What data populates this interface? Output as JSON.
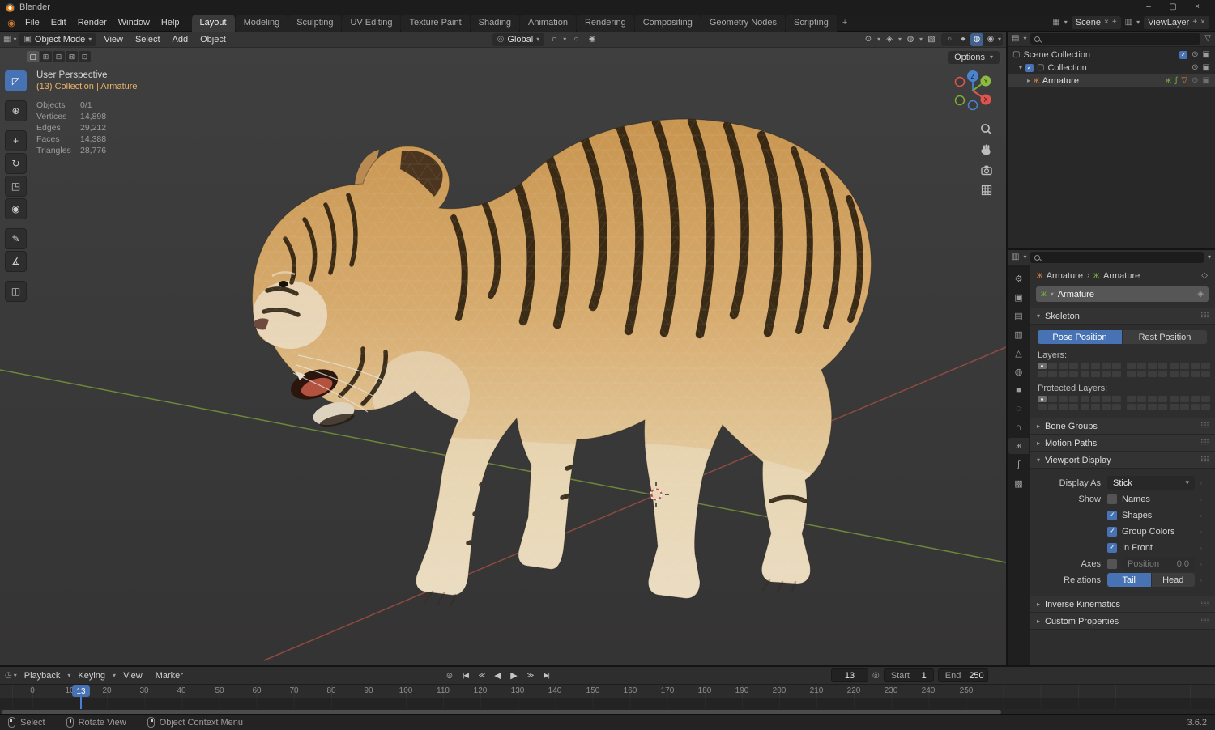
{
  "icons": {
    "dropdown": "▾",
    "collapsed": "▸",
    "expanded": "▾",
    "check": "✓",
    "close": "×",
    "minimize": "–",
    "maximize": "▢",
    "drag": "⠿⠿",
    "grid": "▦",
    "list": "▤",
    "sliders": "▥",
    "clock": "◷",
    "cube": "▣",
    "orientation": "◎",
    "magnet": "∩",
    "proportional": "○",
    "falloff": "◉",
    "visibility": "⊙",
    "gizmos": "◈",
    "overlays": "◍",
    "xray": "▧",
    "shade_wire": "○",
    "shade_solid": "●",
    "shade_material": "◍",
    "shade_render": "◉",
    "box": "▢",
    "person": "ж",
    "eye": "⊙",
    "camera": "▣",
    "filter": "▽",
    "pin": "◇",
    "shield": "◈",
    "chevron": "›",
    "decorator": "◦",
    "record": "◎",
    "bone": "∫",
    "triangle": "▽",
    "plus": "+",
    "select_modes": [
      "▢",
      "⊞",
      "⊟",
      "⊠",
      "⊡"
    ],
    "tools": [
      "◸",
      "⊕",
      "+",
      "↻",
      "◳",
      "◉",
      "✎",
      "∡",
      "◫"
    ],
    "transport": [
      "|◀",
      "≪",
      "◀",
      "▶",
      "≫",
      "▶|"
    ],
    "ptabs": [
      "⚙",
      "▣",
      "▤",
      "▥",
      "△",
      "◍",
      "■",
      "◌",
      "∩",
      "ж",
      "∫",
      "▩"
    ],
    "axis_z": "Z",
    "axis_x": "X",
    "axis_y": "Y"
  },
  "titlebar": {
    "title": "Blender"
  },
  "topbar": {
    "menus": [
      "File",
      "Edit",
      "Render",
      "Window",
      "Help"
    ],
    "workspaces": [
      "Layout",
      "Modeling",
      "Sculpting",
      "UV Editing",
      "Texture Paint",
      "Shading",
      "Animation",
      "Rendering",
      "Compositing",
      "Geometry Nodes",
      "Scripting"
    ],
    "add_tab": "+",
    "scene_label": "Scene",
    "viewlayer_label": "ViewLayer"
  },
  "viewport": {
    "mode": "Object Mode",
    "menus": [
      "View",
      "Select",
      "Add",
      "Object"
    ],
    "orientation": "Global",
    "options": "Options",
    "overlay": {
      "perspective": "User Perspective",
      "collection": "(13) Collection | Armature",
      "stats": [
        {
          "label": "Objects",
          "value": "0/1"
        },
        {
          "label": "Vertices",
          "value": "14,898"
        },
        {
          "label": "Edges",
          "value": "29,212"
        },
        {
          "label": "Faces",
          "value": "14,388"
        },
        {
          "label": "Triangles",
          "value": "28,776"
        }
      ]
    }
  },
  "outliner": {
    "rows": [
      {
        "label": "Scene Collection"
      },
      {
        "label": "Collection"
      },
      {
        "label": "Armature"
      }
    ]
  },
  "properties": {
    "breadcrumb": {
      "object": "Armature",
      "data": "Armature"
    },
    "name_value": "Armature",
    "skeleton": {
      "title": "Skeleton",
      "pose": "Pose Position",
      "rest": "Rest Position",
      "layers": "Layers:",
      "protected_layers": "Protected Layers:"
    },
    "bone_groups": "Bone Groups",
    "motion_paths": "Motion Paths",
    "viewport_display": {
      "title": "Viewport Display",
      "display_as": "Display As",
      "display_as_value": "Stick",
      "show": "Show",
      "names": "Names",
      "shapes": "Shapes",
      "group_colors": "Group Colors",
      "in_front": "In Front",
      "axes": "Axes",
      "position": "Position",
      "position_value": "0.0",
      "relations": "Relations",
      "tail": "Tail",
      "head": "Head"
    },
    "inverse_kinematics": "Inverse Kinematics",
    "custom_properties": "Custom Properties"
  },
  "timeline": {
    "menus": [
      "Playback",
      "Keying",
      "View",
      "Marker"
    ],
    "current_frame": "13",
    "start_label": "Start",
    "start_value": "1",
    "end_label": "End",
    "end_value": "250",
    "ticks": [
      "0",
      "10",
      "20",
      "30",
      "40",
      "50",
      "60",
      "70",
      "80",
      "90",
      "100",
      "110",
      "120",
      "130",
      "140",
      "150",
      "160",
      "170",
      "180",
      "190",
      "200",
      "210",
      "220",
      "230",
      "240",
      "250"
    ]
  },
  "statusbar": {
    "select": "Select",
    "rotate": "Rotate View",
    "context": "Object Context Menu",
    "version": "3.6.2"
  }
}
